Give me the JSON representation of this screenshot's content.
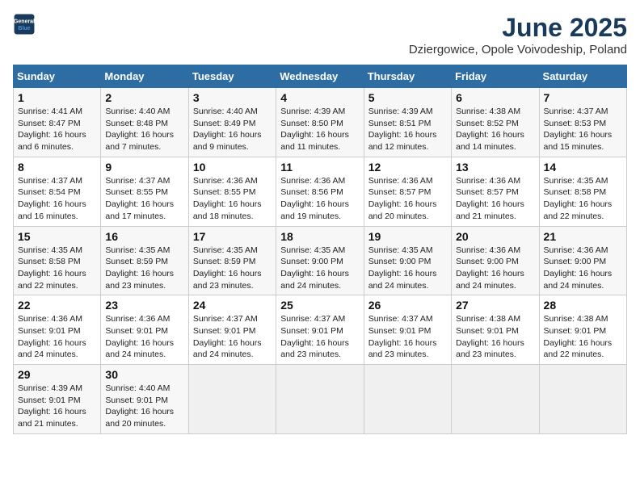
{
  "header": {
    "logo_line1": "General",
    "logo_line2": "Blue",
    "month": "June 2025",
    "location": "Dziergowice, Opole Voivodeship, Poland"
  },
  "weekdays": [
    "Sunday",
    "Monday",
    "Tuesday",
    "Wednesday",
    "Thursday",
    "Friday",
    "Saturday"
  ],
  "weeks": [
    [
      {
        "day": "1",
        "info": "Sunrise: 4:41 AM\nSunset: 8:47 PM\nDaylight: 16 hours\nand 6 minutes."
      },
      {
        "day": "2",
        "info": "Sunrise: 4:40 AM\nSunset: 8:48 PM\nDaylight: 16 hours\nand 7 minutes."
      },
      {
        "day": "3",
        "info": "Sunrise: 4:40 AM\nSunset: 8:49 PM\nDaylight: 16 hours\nand 9 minutes."
      },
      {
        "day": "4",
        "info": "Sunrise: 4:39 AM\nSunset: 8:50 PM\nDaylight: 16 hours\nand 11 minutes."
      },
      {
        "day": "5",
        "info": "Sunrise: 4:39 AM\nSunset: 8:51 PM\nDaylight: 16 hours\nand 12 minutes."
      },
      {
        "day": "6",
        "info": "Sunrise: 4:38 AM\nSunset: 8:52 PM\nDaylight: 16 hours\nand 14 minutes."
      },
      {
        "day": "7",
        "info": "Sunrise: 4:37 AM\nSunset: 8:53 PM\nDaylight: 16 hours\nand 15 minutes."
      }
    ],
    [
      {
        "day": "8",
        "info": "Sunrise: 4:37 AM\nSunset: 8:54 PM\nDaylight: 16 hours\nand 16 minutes."
      },
      {
        "day": "9",
        "info": "Sunrise: 4:37 AM\nSunset: 8:55 PM\nDaylight: 16 hours\nand 17 minutes."
      },
      {
        "day": "10",
        "info": "Sunrise: 4:36 AM\nSunset: 8:55 PM\nDaylight: 16 hours\nand 18 minutes."
      },
      {
        "day": "11",
        "info": "Sunrise: 4:36 AM\nSunset: 8:56 PM\nDaylight: 16 hours\nand 19 minutes."
      },
      {
        "day": "12",
        "info": "Sunrise: 4:36 AM\nSunset: 8:57 PM\nDaylight: 16 hours\nand 20 minutes."
      },
      {
        "day": "13",
        "info": "Sunrise: 4:36 AM\nSunset: 8:57 PM\nDaylight: 16 hours\nand 21 minutes."
      },
      {
        "day": "14",
        "info": "Sunrise: 4:35 AM\nSunset: 8:58 PM\nDaylight: 16 hours\nand 22 minutes."
      }
    ],
    [
      {
        "day": "15",
        "info": "Sunrise: 4:35 AM\nSunset: 8:58 PM\nDaylight: 16 hours\nand 22 minutes."
      },
      {
        "day": "16",
        "info": "Sunrise: 4:35 AM\nSunset: 8:59 PM\nDaylight: 16 hours\nand 23 minutes."
      },
      {
        "day": "17",
        "info": "Sunrise: 4:35 AM\nSunset: 8:59 PM\nDaylight: 16 hours\nand 23 minutes."
      },
      {
        "day": "18",
        "info": "Sunrise: 4:35 AM\nSunset: 9:00 PM\nDaylight: 16 hours\nand 24 minutes."
      },
      {
        "day": "19",
        "info": "Sunrise: 4:35 AM\nSunset: 9:00 PM\nDaylight: 16 hours\nand 24 minutes."
      },
      {
        "day": "20",
        "info": "Sunrise: 4:36 AM\nSunset: 9:00 PM\nDaylight: 16 hours\nand 24 minutes."
      },
      {
        "day": "21",
        "info": "Sunrise: 4:36 AM\nSunset: 9:00 PM\nDaylight: 16 hours\nand 24 minutes."
      }
    ],
    [
      {
        "day": "22",
        "info": "Sunrise: 4:36 AM\nSunset: 9:01 PM\nDaylight: 16 hours\nand 24 minutes."
      },
      {
        "day": "23",
        "info": "Sunrise: 4:36 AM\nSunset: 9:01 PM\nDaylight: 16 hours\nand 24 minutes."
      },
      {
        "day": "24",
        "info": "Sunrise: 4:37 AM\nSunset: 9:01 PM\nDaylight: 16 hours\nand 24 minutes."
      },
      {
        "day": "25",
        "info": "Sunrise: 4:37 AM\nSunset: 9:01 PM\nDaylight: 16 hours\nand 23 minutes."
      },
      {
        "day": "26",
        "info": "Sunrise: 4:37 AM\nSunset: 9:01 PM\nDaylight: 16 hours\nand 23 minutes."
      },
      {
        "day": "27",
        "info": "Sunrise: 4:38 AM\nSunset: 9:01 PM\nDaylight: 16 hours\nand 23 minutes."
      },
      {
        "day": "28",
        "info": "Sunrise: 4:38 AM\nSunset: 9:01 PM\nDaylight: 16 hours\nand 22 minutes."
      }
    ],
    [
      {
        "day": "29",
        "info": "Sunrise: 4:39 AM\nSunset: 9:01 PM\nDaylight: 16 hours\nand 21 minutes."
      },
      {
        "day": "30",
        "info": "Sunrise: 4:40 AM\nSunset: 9:01 PM\nDaylight: 16 hours\nand 20 minutes."
      },
      {
        "day": "",
        "info": ""
      },
      {
        "day": "",
        "info": ""
      },
      {
        "day": "",
        "info": ""
      },
      {
        "day": "",
        "info": ""
      },
      {
        "day": "",
        "info": ""
      }
    ]
  ]
}
